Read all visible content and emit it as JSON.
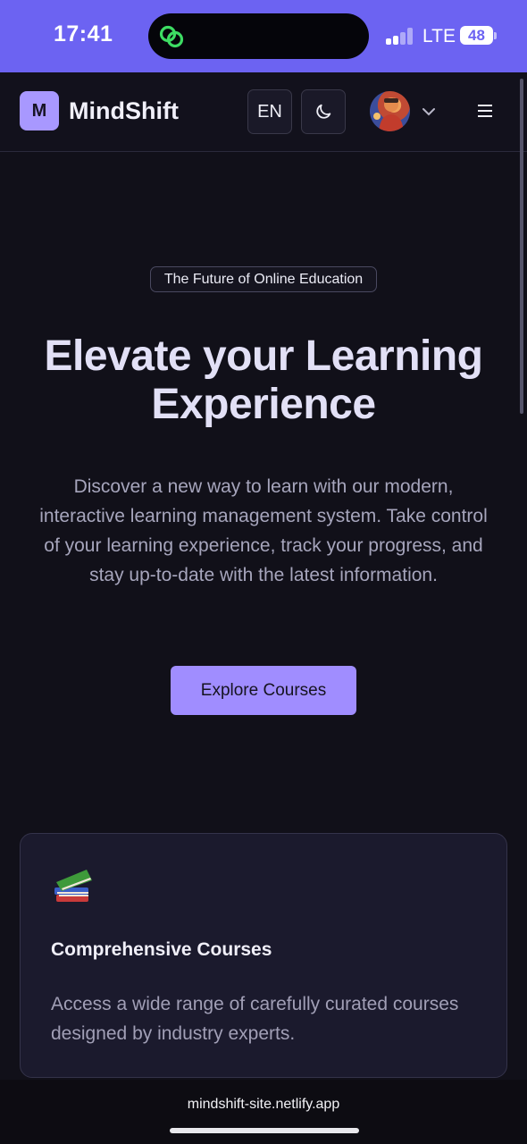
{
  "status_bar": {
    "time": "17:41",
    "network": "LTE",
    "battery": "48",
    "island_icon": "link-app-icon"
  },
  "navbar": {
    "logo_letter": "M",
    "brand": "MindShift",
    "language": "EN",
    "theme_icon": "moon-icon",
    "avatar_icon": "avatar-icon",
    "dropdown_icon": "chevron-down-icon",
    "menu_icon": "hamburger-menu-icon",
    "accent": "#a898ff"
  },
  "hero": {
    "badge": "The Future of Online Education",
    "title_line1": "Elevate your Learning",
    "title_line2": "Experience",
    "description_lines": [
      "Discover a new way to learn with our modern,",
      "interactive learning management system. Take control",
      "of your learning experience, track your progress, and",
      "stay up-to-date with the latest information."
    ],
    "cta_label": "Explore Courses",
    "cta_color": "#a08dff"
  },
  "features": [
    {
      "icon": "books-icon",
      "title": "Comprehensive Courses",
      "description_lines": [
        "Access a wide range of carefully curated courses",
        "designed by industry experts."
      ]
    }
  ],
  "browser": {
    "url": "mindshift-site.netlify.app"
  },
  "colors": {
    "status_bar": "#6c63f2",
    "background": "#111019",
    "card": "#1b1a2d"
  }
}
